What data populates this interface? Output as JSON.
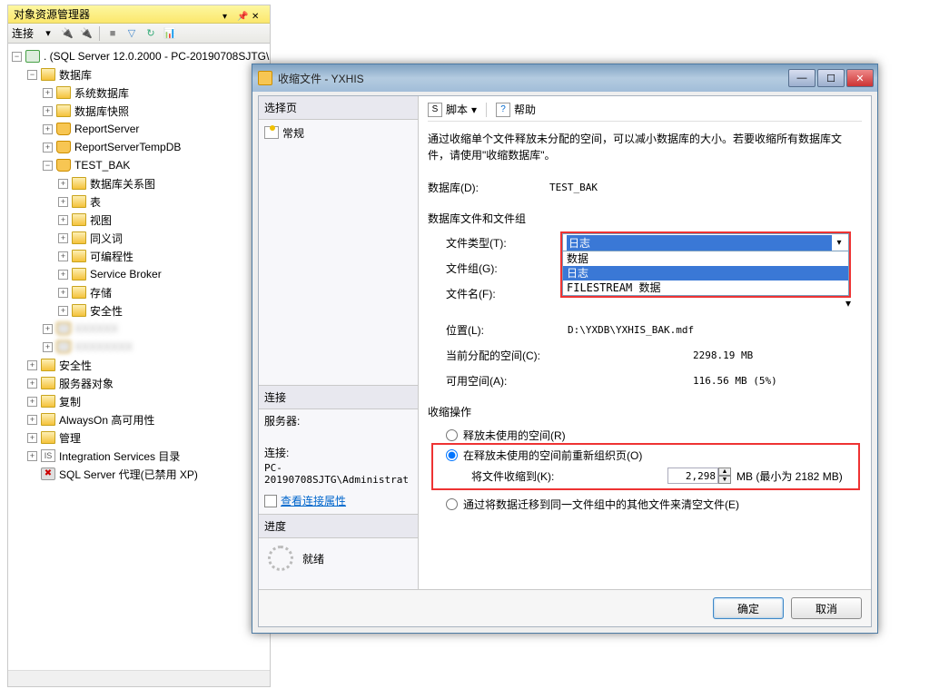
{
  "explorer": {
    "title": "对象资源管理器",
    "connect_label": "连接",
    "root": ". (SQL Server 12.0.2000 - PC-20190708SJTG\\",
    "db_root": "数据库",
    "items_l3": [
      "系统数据库",
      "数据库快照",
      "ReportServer",
      "ReportServerTempDB",
      "TEST_BAK"
    ],
    "test_bak_children": [
      "数据库关系图",
      "表",
      "视图",
      "同义词",
      "可编程性",
      "Service Broker",
      "存储",
      "安全性"
    ],
    "items_l2_rest": [
      "安全性",
      "服务器对象",
      "复制",
      "AlwaysOn 高可用性",
      "管理",
      "Integration Services 目录"
    ],
    "sql_agent": "SQL Server 代理(已禁用 XP)"
  },
  "dialog": {
    "title": "收缩文件 - YXHIS",
    "left": {
      "select_page": "选择页",
      "nav_general": "常规",
      "connection_head": "连接",
      "server_label": "服务器:",
      "server_value": "",
      "conn_label": "连接:",
      "conn_value": "PC-20190708SJTG\\Administrat",
      "view_props": "查看连接属性",
      "progress_head": "进度",
      "ready": "就绪"
    },
    "right": {
      "script_label": "脚本",
      "help_label": "帮助",
      "desc": "通过收缩单个文件释放未分配的空间，可以减小数据库的大小。若要收缩所有数据库文件，请使用\"收缩数据库\"。",
      "db_label": "数据库(D):",
      "db_value": "TEST_BAK",
      "group_label": "数据库文件和文件组",
      "file_type_label": "文件类型(T):",
      "file_type_value": "日志",
      "file_type_options": [
        "数据",
        "日志",
        "FILESTREAM 数据"
      ],
      "filegroup_label": "文件组(G):",
      "filename_label": "文件名(F):",
      "location_label": "位置(L):",
      "location_value": "D:\\YXDB\\YXHIS_BAK.mdf",
      "alloc_label": "当前分配的空间(C):",
      "alloc_value": "2298.19 MB",
      "avail_label": "可用空间(A):",
      "avail_value": "116.56 MB (5%)",
      "shrink_head": "收缩操作",
      "opt1": "释放未使用的空间(R)",
      "opt2": "在释放未使用的空间前重新组织页(O)",
      "shrink_to_label": "将文件收缩到(K):",
      "shrink_to_value": "2,298",
      "shrink_to_suffix": "MB (最小为 2182 MB)",
      "opt3": "通过将数据迁移到同一文件组中的其他文件来清空文件(E)"
    },
    "ok": "确定",
    "cancel": "取消"
  }
}
